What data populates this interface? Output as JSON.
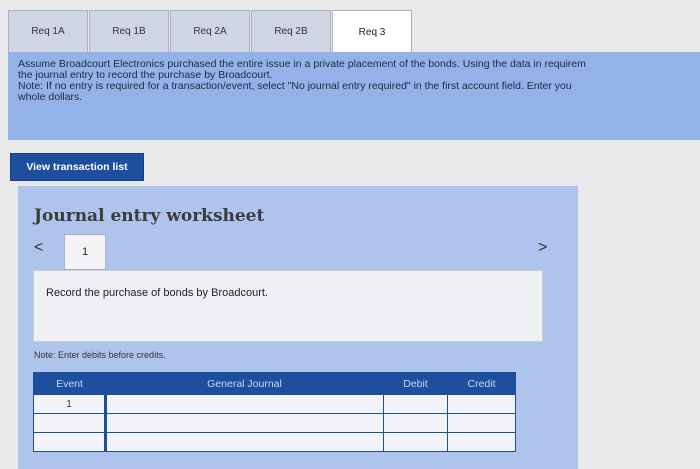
{
  "tabs": [
    {
      "label": "Req 1A"
    },
    {
      "label": "Req 1B"
    },
    {
      "label": "Req 2A"
    },
    {
      "label": "Req 2B"
    },
    {
      "label": "Req 3"
    }
  ],
  "active_tab": "Req 3",
  "instructions": {
    "line1": "Assume Broadcourt Electronics purchased the entire issue in a private placement of the bonds. Using the data in requirem",
    "line2": "the journal entry to record the purchase by Broadcourt.",
    "line3": "Note: If no entry is required for a transaction/event, select \"No journal entry required\" in the first account field. Enter you",
    "line4": "whole dollars."
  },
  "view_button": {
    "label": "View transaction list"
  },
  "worksheet": {
    "title": "Journal entry worksheet",
    "prev_icon": "<",
    "next_icon": ">",
    "current_page": "1",
    "description": "Record the purchase of bonds by Broadcourt.",
    "note": "Note: Enter debits before credits."
  },
  "table": {
    "headers": {
      "event": "Event",
      "journal": "General Journal",
      "debit": "Debit",
      "credit": "Credit"
    },
    "rows": [
      {
        "event": "1",
        "account": "",
        "debit": "",
        "credit": ""
      },
      {
        "event": "",
        "account": "",
        "debit": "",
        "credit": ""
      },
      {
        "event": "",
        "account": "",
        "debit": "",
        "credit": ""
      }
    ]
  }
}
